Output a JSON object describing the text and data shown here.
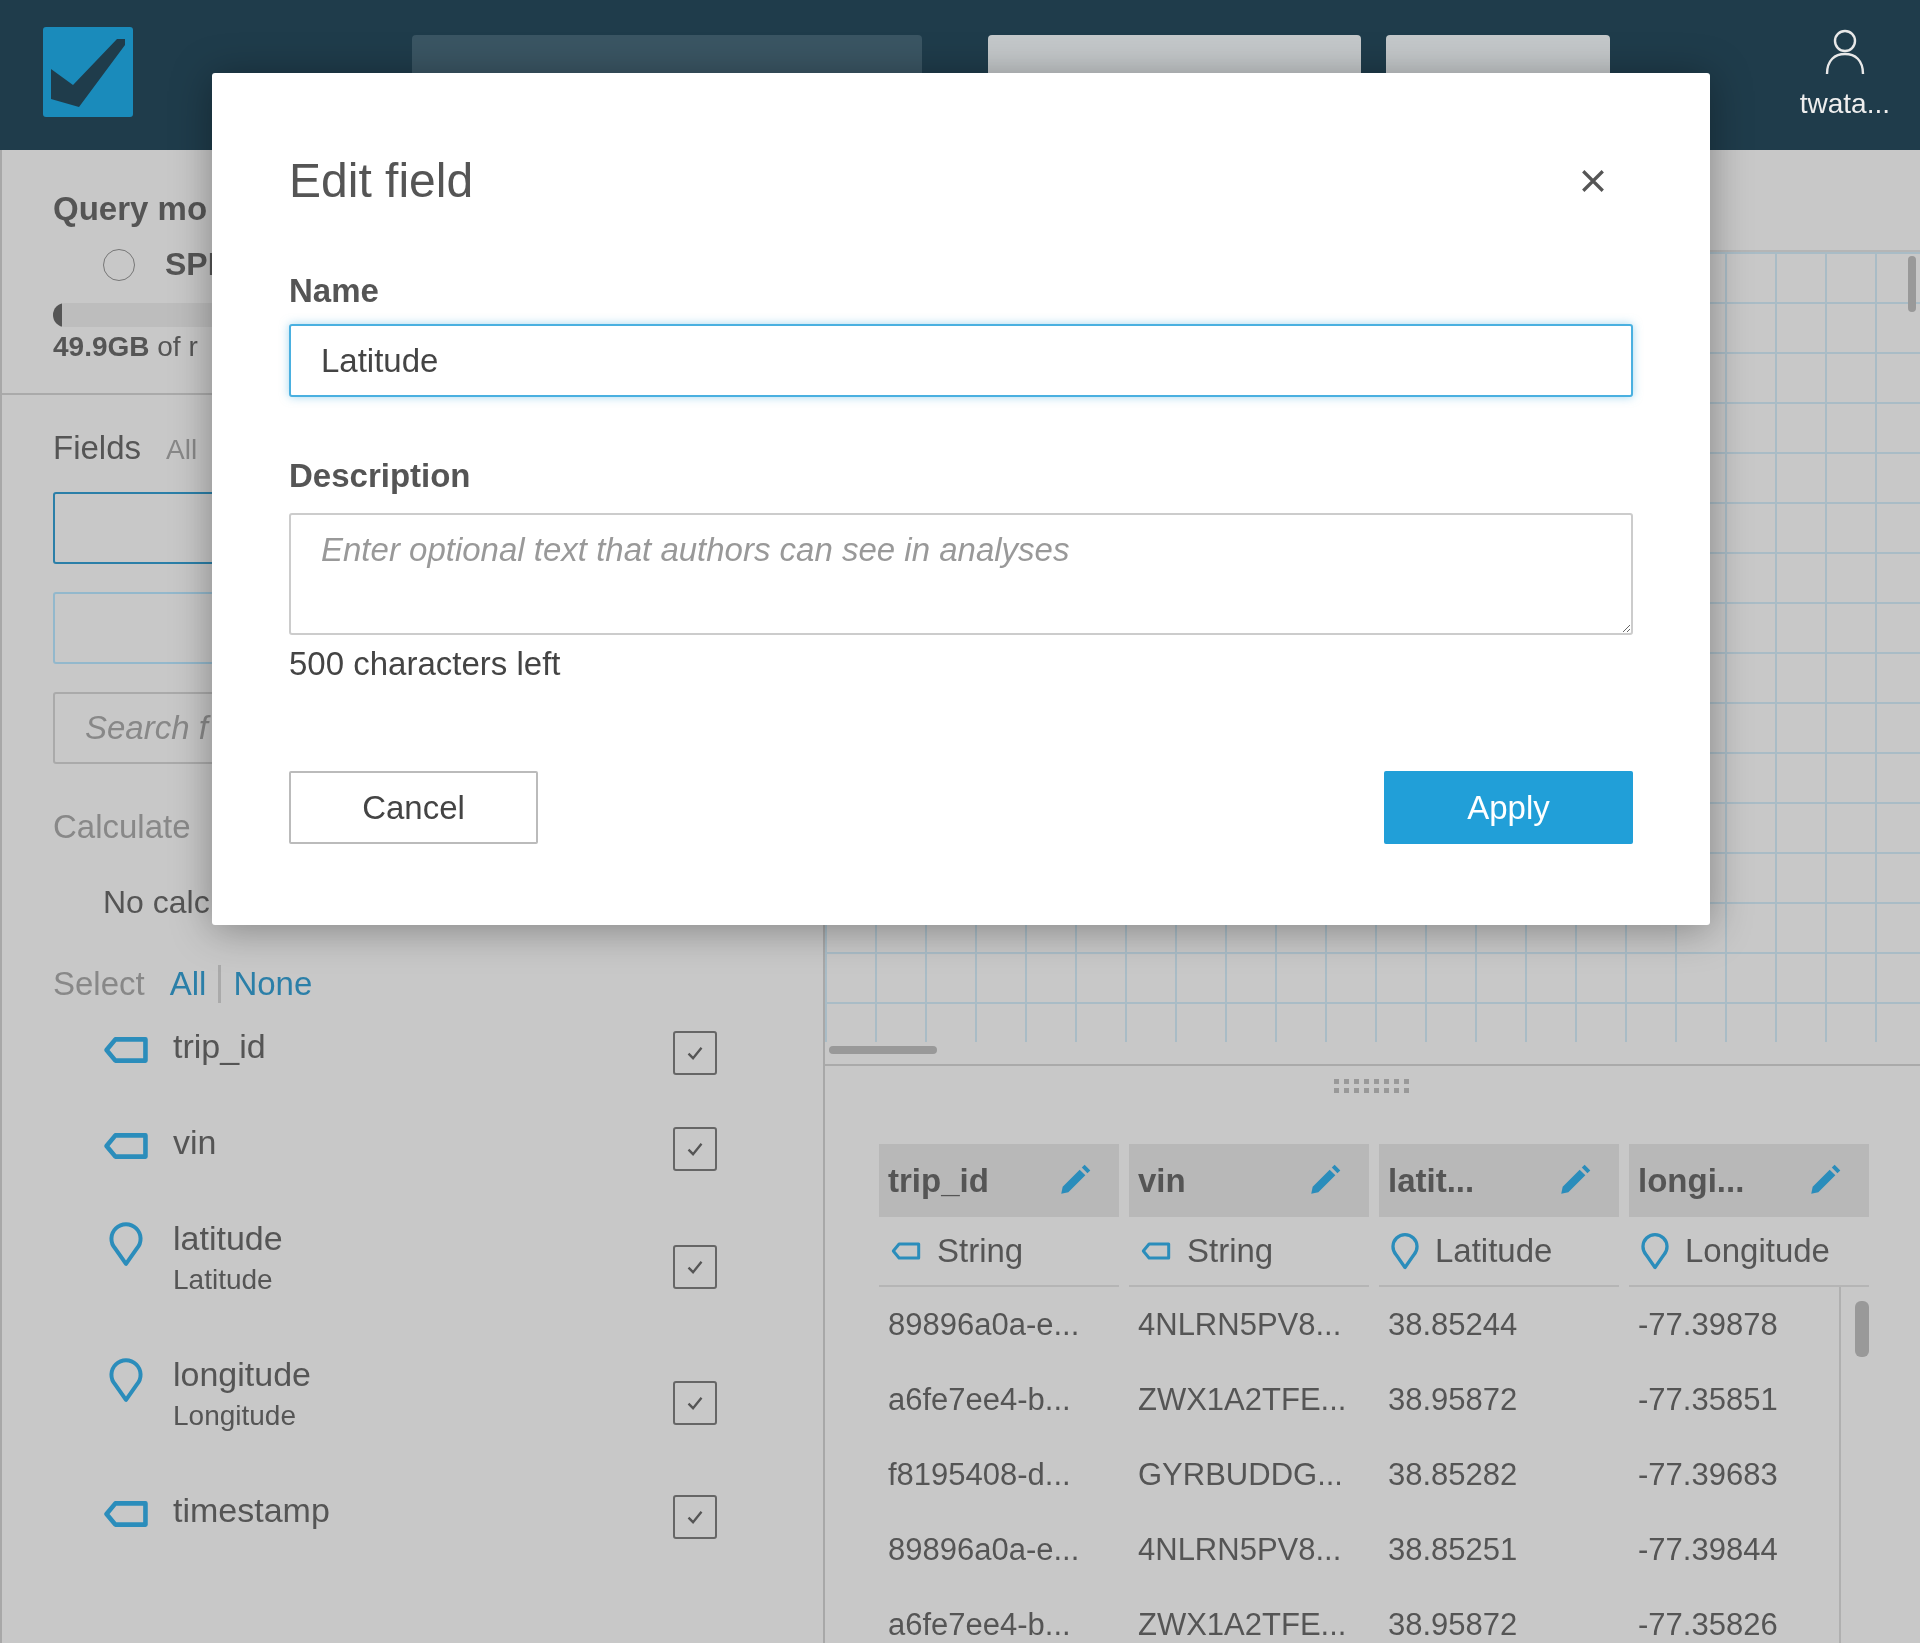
{
  "top_bar": {
    "user": "twata..."
  },
  "left_panel": {
    "query_mode_label": "Query mo",
    "query_mode_option": {
      "label": "SPI",
      "selected": false
    },
    "capacity": {
      "level": 0.03,
      "text": "**49.9GB** of r"
    },
    "fields_title": "Fields",
    "fields_filter": "All",
    "search_placeholder": "Search f",
    "calculated_title": "Calculate",
    "calculated_empty": "No calc",
    "select_label": "Select",
    "select_all": "All",
    "select_none": "None",
    "fields": [
      {
        "name": "trip_id",
        "kind": "tag",
        "checked": true
      },
      {
        "name": "vin",
        "kind": "tag",
        "checked": true
      },
      {
        "name": "latitude",
        "subtitle": "Latitude",
        "kind": "pin",
        "checked": true
      },
      {
        "name": "longitude",
        "subtitle": "Longitude",
        "kind": "pin",
        "checked": true
      },
      {
        "name": "timestamp",
        "kind": "tag",
        "checked": true
      }
    ]
  },
  "preview": {
    "columns": [
      {
        "name": "trip_id",
        "kind": "tag",
        "type_label": "String"
      },
      {
        "name": "vin",
        "kind": "tag",
        "type_label": "String"
      },
      {
        "name": "latit...",
        "kind": "pin",
        "type_label": "Latitude"
      },
      {
        "name": "longi...",
        "kind": "pin",
        "type_label": "Longitude"
      }
    ],
    "rows": [
      [
        "89896a0a-e...",
        "4NLRN5PV8...",
        "38.85244",
        "-77.39878"
      ],
      [
        "a6fe7ee4-b...",
        "ZWX1A2TFE...",
        "38.95872",
        "-77.35851"
      ],
      [
        "f8195408-d...",
        "GYRBUDDG...",
        "38.85282",
        "-77.39683"
      ],
      [
        "89896a0a-e...",
        "4NLRN5PV8...",
        "38.85251",
        "-77.39844"
      ],
      [
        "a6fe7ee4-b...",
        "ZWX1A2TFE...",
        "38.95872",
        "-77.35826"
      ]
    ]
  },
  "dialog": {
    "title": "Edit field",
    "name_label": "Name",
    "name_value": "Latitude",
    "description_label": "Description",
    "description_placeholder": "Enter optional text that authors can see in analyses",
    "chars_left": "500 characters left",
    "cancel": "Cancel",
    "apply": "Apply"
  }
}
